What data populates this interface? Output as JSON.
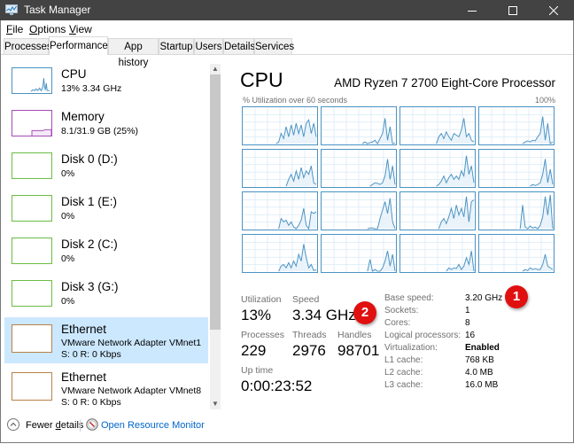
{
  "window": {
    "title": "Task Manager",
    "controls": {
      "minimize": "minimize",
      "maximize": "maximize",
      "close": "close"
    }
  },
  "menu": {
    "items": [
      {
        "label": "File",
        "accel": "F",
        "rest": "ile"
      },
      {
        "label": "Options",
        "accel": "O",
        "rest": "ptions"
      },
      {
        "label": "View",
        "accel": "V",
        "rest": "iew"
      }
    ]
  },
  "tabs": [
    {
      "label": "Processes",
      "active": false
    },
    {
      "label": "Performance",
      "active": true
    },
    {
      "label": "App history",
      "active": false
    },
    {
      "label": "Startup",
      "active": false
    },
    {
      "label": "Users",
      "active": false
    },
    {
      "label": "Details",
      "active": false
    },
    {
      "label": "Services",
      "active": false
    }
  ],
  "sidebar": {
    "items": [
      {
        "title": "CPU",
        "lines": [
          "13% 3.34 GHz"
        ],
        "color": "#4a93c4",
        "selected": false
      },
      {
        "title": "Memory",
        "lines": [
          "8.1/31.9 GB (25%)"
        ],
        "color": "#a64ab8",
        "selected": false
      },
      {
        "title": "Disk 0 (D:)",
        "lines": [
          "0%"
        ],
        "color": "#6cbd45",
        "selected": false
      },
      {
        "title": "Disk 1 (E:)",
        "lines": [
          "0%"
        ],
        "color": "#6cbd45",
        "selected": false
      },
      {
        "title": "Disk 2 (C:)",
        "lines": [
          "0%"
        ],
        "color": "#6cbd45",
        "selected": false
      },
      {
        "title": "Disk 3 (G:)",
        "lines": [
          "0%"
        ],
        "color": "#6cbd45",
        "selected": false
      },
      {
        "title": "Ethernet",
        "lines": [
          "VMware Network Adapter VMnet1",
          "S: 0 R: 0 Kbps"
        ],
        "color": "#b8814a",
        "selected": true
      },
      {
        "title": "Ethernet",
        "lines": [
          "VMware Network Adapter VMnet8",
          "S: 0 R: 0 Kbps"
        ],
        "color": "#b8814a",
        "selected": false
      }
    ],
    "scroll_position_fraction": 0.0,
    "scroll_visible_fraction": 0.77
  },
  "main": {
    "title": "CPU",
    "model": "AMD Ryzen 7 2700 Eight-Core Processor",
    "graph_label": "% Utilization over 60 seconds",
    "graph_max": "100%",
    "logical_processor_graphs": 16,
    "stats": {
      "utilization": {
        "label": "Utilization",
        "value": "13%"
      },
      "speed": {
        "label": "Speed",
        "value": "3.34 GHz"
      },
      "processes": {
        "label": "Processes",
        "value": "229"
      },
      "threads": {
        "label": "Threads",
        "value": "2976"
      },
      "handles": {
        "label": "Handles",
        "value": "98701"
      },
      "uptime": {
        "label": "Up time",
        "value": "0:00:23:52"
      }
    },
    "specs": [
      {
        "label": "Base speed:",
        "value": "3.20 GHz",
        "bold": false
      },
      {
        "label": "Sockets:",
        "value": "1",
        "bold": false
      },
      {
        "label": "Cores:",
        "value": "8",
        "bold": false
      },
      {
        "label": "Logical processors:",
        "value": "16",
        "bold": false
      },
      {
        "label": "Virtualization:",
        "value": "Enabled",
        "bold": true
      },
      {
        "label": "L1 cache:",
        "value": "768 KB",
        "bold": false
      },
      {
        "label": "L2 cache:",
        "value": "4.0 MB",
        "bold": false
      },
      {
        "label": "L3 cache:",
        "value": "16.0 MB",
        "bold": false
      }
    ],
    "annotations": [
      {
        "number": "1",
        "target": "base-speed"
      },
      {
        "number": "2",
        "target": "speed"
      }
    ]
  },
  "footer": {
    "fewer_details": {
      "pre": "Fewer ",
      "accel": "d",
      "post": "etails"
    },
    "resource_monitor": "Open Resource Monitor"
  },
  "colors": {
    "titlebar": "#434343",
    "cpu_accent": "#4a93c4",
    "selected_bg": "#cce8ff",
    "link": "#0066cc",
    "badge": "#e01010"
  }
}
